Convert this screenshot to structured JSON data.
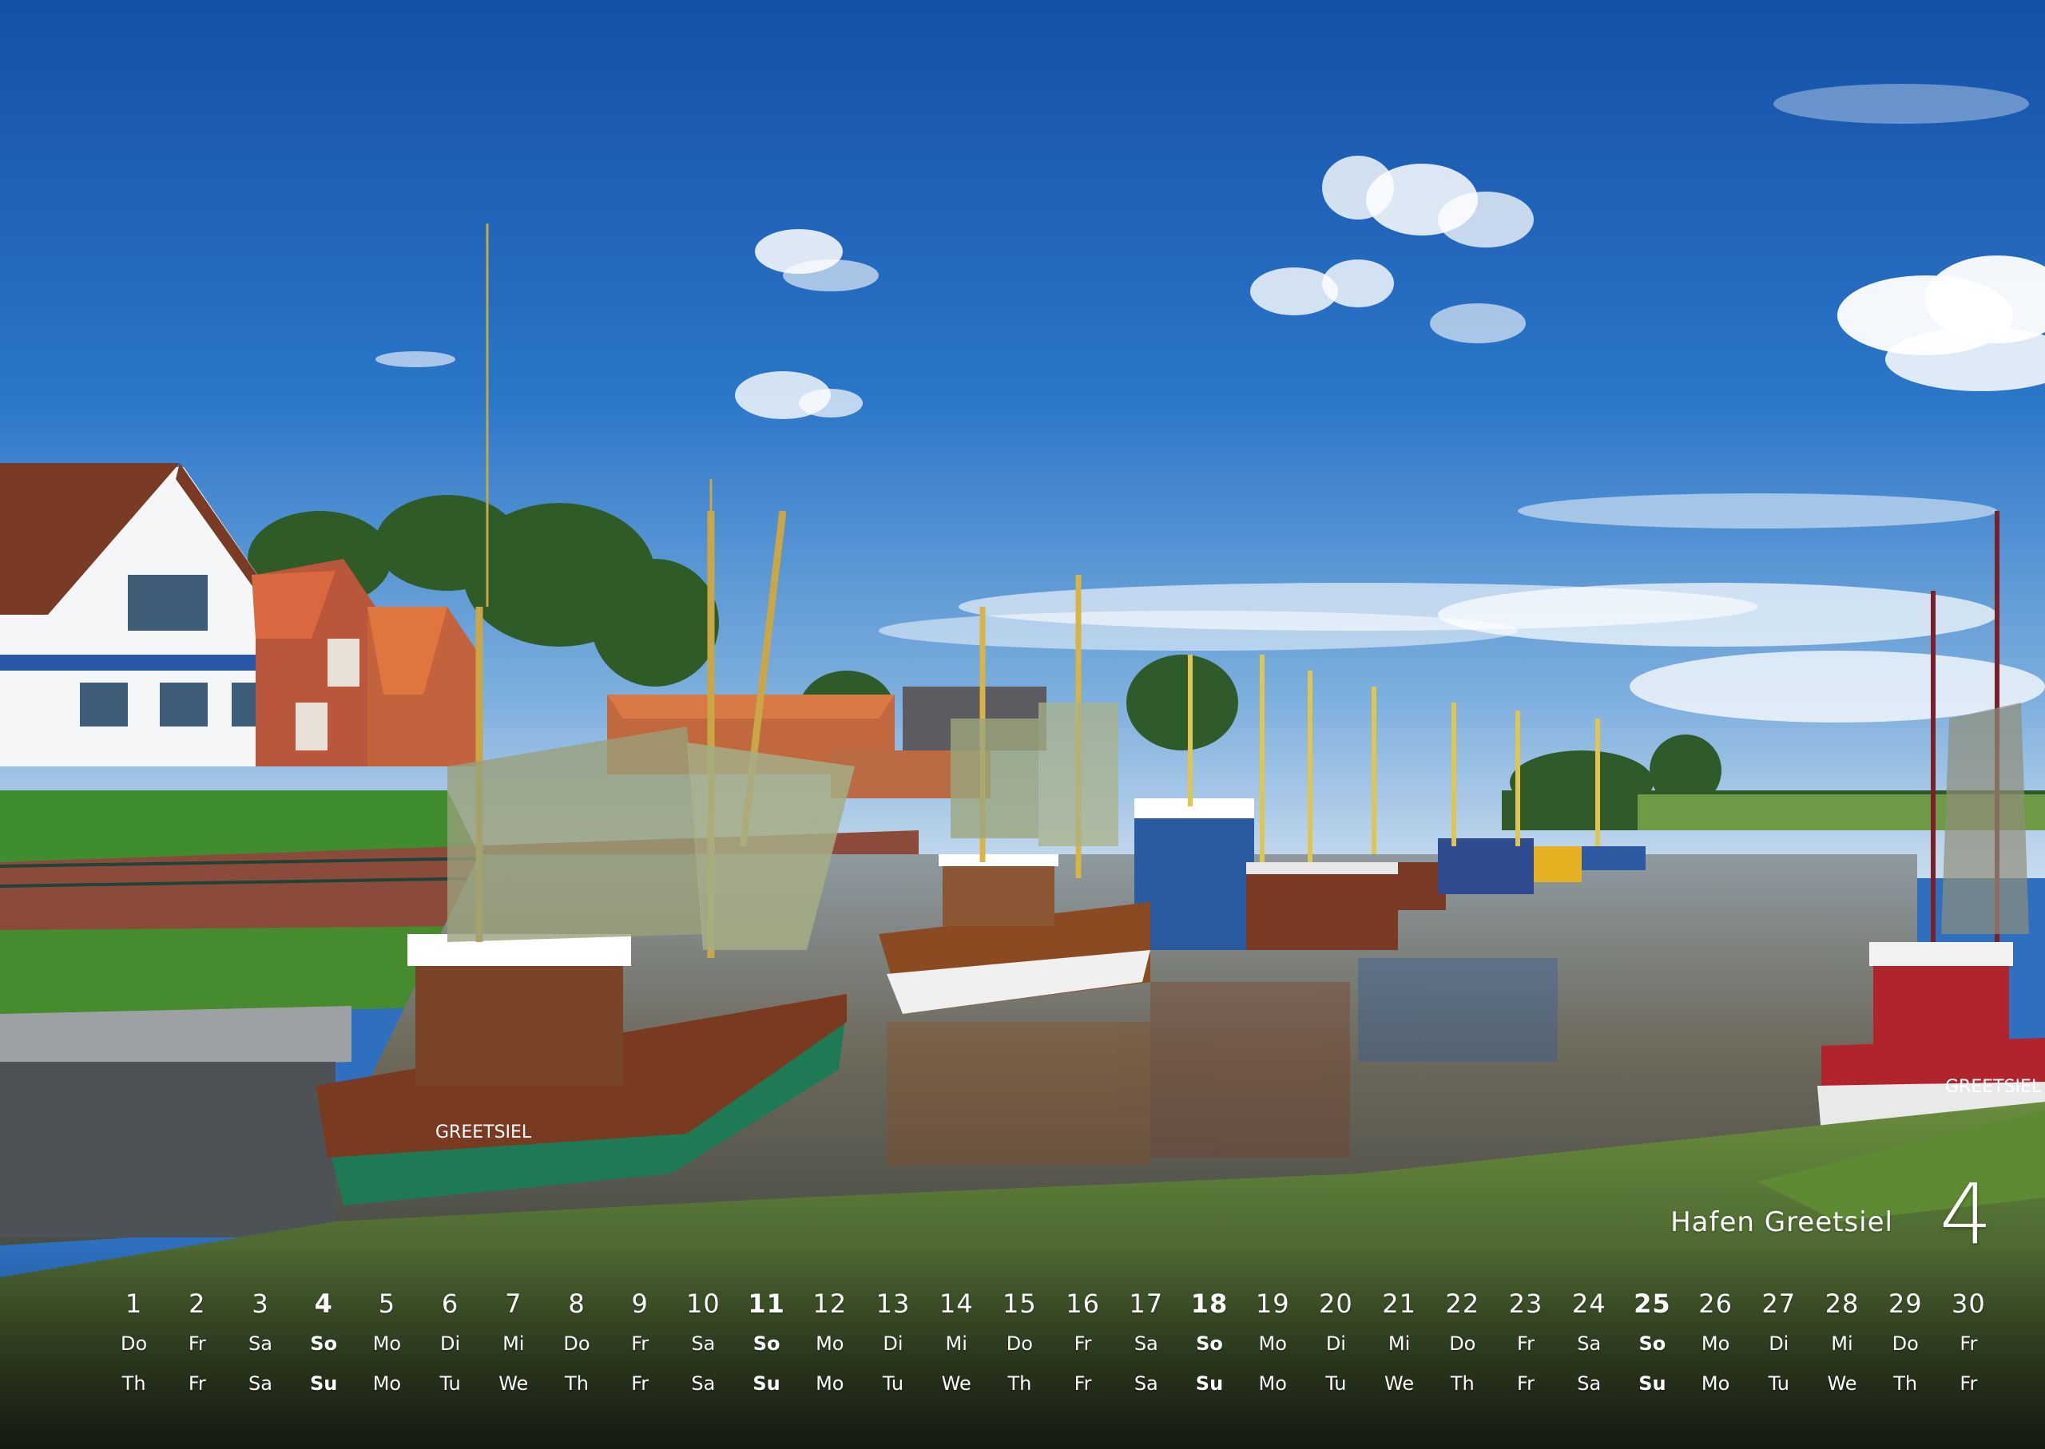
{
  "caption": {
    "title": "Hafen Greetsiel",
    "month": "4"
  },
  "photo": {
    "boat_names": [
      "GREETSIEL",
      "GREETSIEL"
    ],
    "colors": {
      "sky": "#1f63b8",
      "water": "#5a6e76",
      "grass": "#4f8a32",
      "hull_green": "#1d7a55",
      "hull_red": "#b2242b"
    }
  },
  "calendar": {
    "days": [
      {
        "num": "1",
        "de": "Do",
        "en": "Th",
        "sunday": false
      },
      {
        "num": "2",
        "de": "Fr",
        "en": "Fr",
        "sunday": false
      },
      {
        "num": "3",
        "de": "Sa",
        "en": "Sa",
        "sunday": false
      },
      {
        "num": "4",
        "de": "So",
        "en": "Su",
        "sunday": true
      },
      {
        "num": "5",
        "de": "Mo",
        "en": "Mo",
        "sunday": false
      },
      {
        "num": "6",
        "de": "Di",
        "en": "Tu",
        "sunday": false
      },
      {
        "num": "7",
        "de": "Mi",
        "en": "We",
        "sunday": false
      },
      {
        "num": "8",
        "de": "Do",
        "en": "Th",
        "sunday": false
      },
      {
        "num": "9",
        "de": "Fr",
        "en": "Fr",
        "sunday": false
      },
      {
        "num": "10",
        "de": "Sa",
        "en": "Sa",
        "sunday": false
      },
      {
        "num": "11",
        "de": "So",
        "en": "Su",
        "sunday": true
      },
      {
        "num": "12",
        "de": "Mo",
        "en": "Mo",
        "sunday": false
      },
      {
        "num": "13",
        "de": "Di",
        "en": "Tu",
        "sunday": false
      },
      {
        "num": "14",
        "de": "Mi",
        "en": "We",
        "sunday": false
      },
      {
        "num": "15",
        "de": "Do",
        "en": "Th",
        "sunday": false
      },
      {
        "num": "16",
        "de": "Fr",
        "en": "Fr",
        "sunday": false
      },
      {
        "num": "17",
        "de": "Sa",
        "en": "Sa",
        "sunday": false
      },
      {
        "num": "18",
        "de": "So",
        "en": "Su",
        "sunday": true
      },
      {
        "num": "19",
        "de": "Mo",
        "en": "Mo",
        "sunday": false
      },
      {
        "num": "20",
        "de": "Di",
        "en": "Tu",
        "sunday": false
      },
      {
        "num": "21",
        "de": "Mi",
        "en": "We",
        "sunday": false
      },
      {
        "num": "22",
        "de": "Do",
        "en": "Th",
        "sunday": false
      },
      {
        "num": "23",
        "de": "Fr",
        "en": "Fr",
        "sunday": false
      },
      {
        "num": "24",
        "de": "Sa",
        "en": "Sa",
        "sunday": false
      },
      {
        "num": "25",
        "de": "So",
        "en": "Su",
        "sunday": true
      },
      {
        "num": "26",
        "de": "Mo",
        "en": "Mo",
        "sunday": false
      },
      {
        "num": "27",
        "de": "Di",
        "en": "Tu",
        "sunday": false
      },
      {
        "num": "28",
        "de": "Mi",
        "en": "We",
        "sunday": false
      },
      {
        "num": "29",
        "de": "Do",
        "en": "Th",
        "sunday": false
      },
      {
        "num": "30",
        "de": "Fr",
        "en": "Fr",
        "sunday": false
      }
    ]
  }
}
